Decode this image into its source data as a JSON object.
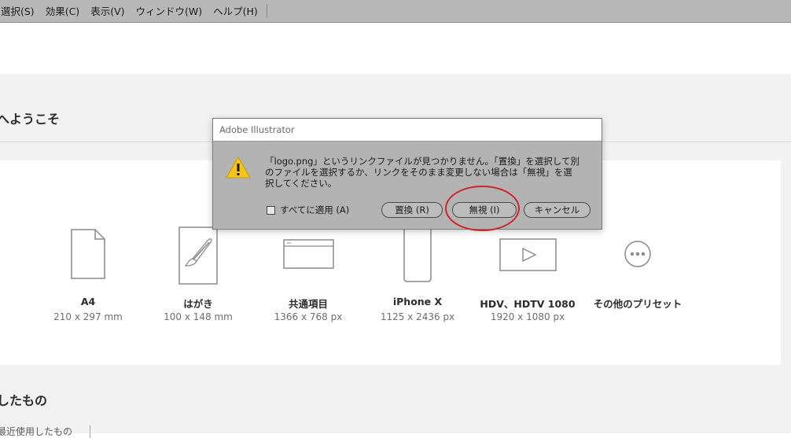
{
  "menubar": {
    "items": [
      "選択(S)",
      "効果(C)",
      "表示(V)",
      "ウィンドウ(W)",
      "ヘルプ(H)"
    ]
  },
  "home": {
    "welcome_title": "へようこそ",
    "presets": [
      {
        "name": "A4",
        "size": "210 x 297 mm",
        "icon": "document-icon"
      },
      {
        "name": "はがき",
        "size": "100 x 148 mm",
        "icon": "brush-icon"
      },
      {
        "name": "共通項目",
        "size": "1366 x 768 px",
        "icon": "browser-window-icon"
      },
      {
        "name": "iPhone X",
        "size": "1125 x 2436 px",
        "icon": "phone-icon"
      },
      {
        "name": "HDV、HDTV 1080",
        "size": "1920 x 1080 px",
        "icon": "video-play-icon"
      },
      {
        "name": "その他のプリセット",
        "size": "",
        "icon": "more-icon"
      }
    ],
    "recent_title": "したもの",
    "recent_tab": "最近使用したもの"
  },
  "dialog": {
    "title": "Adobe Illustrator",
    "message": "「logo.png」というリンクファイルが見つかりません。「置換」を選択して別\nのファイルを選択するか、リンクをそのまま変更しない場合は「無視」を選\n択してください。",
    "apply_all_label": "すべてに適用 (A)",
    "apply_all_checked": false,
    "replace_label": "置換 (R)",
    "ignore_label": "無視 (I)",
    "cancel_label": "キャンセル",
    "icon": "warning-icon",
    "warning_color": "#f5c518",
    "highlight_color": "#d1232a"
  }
}
